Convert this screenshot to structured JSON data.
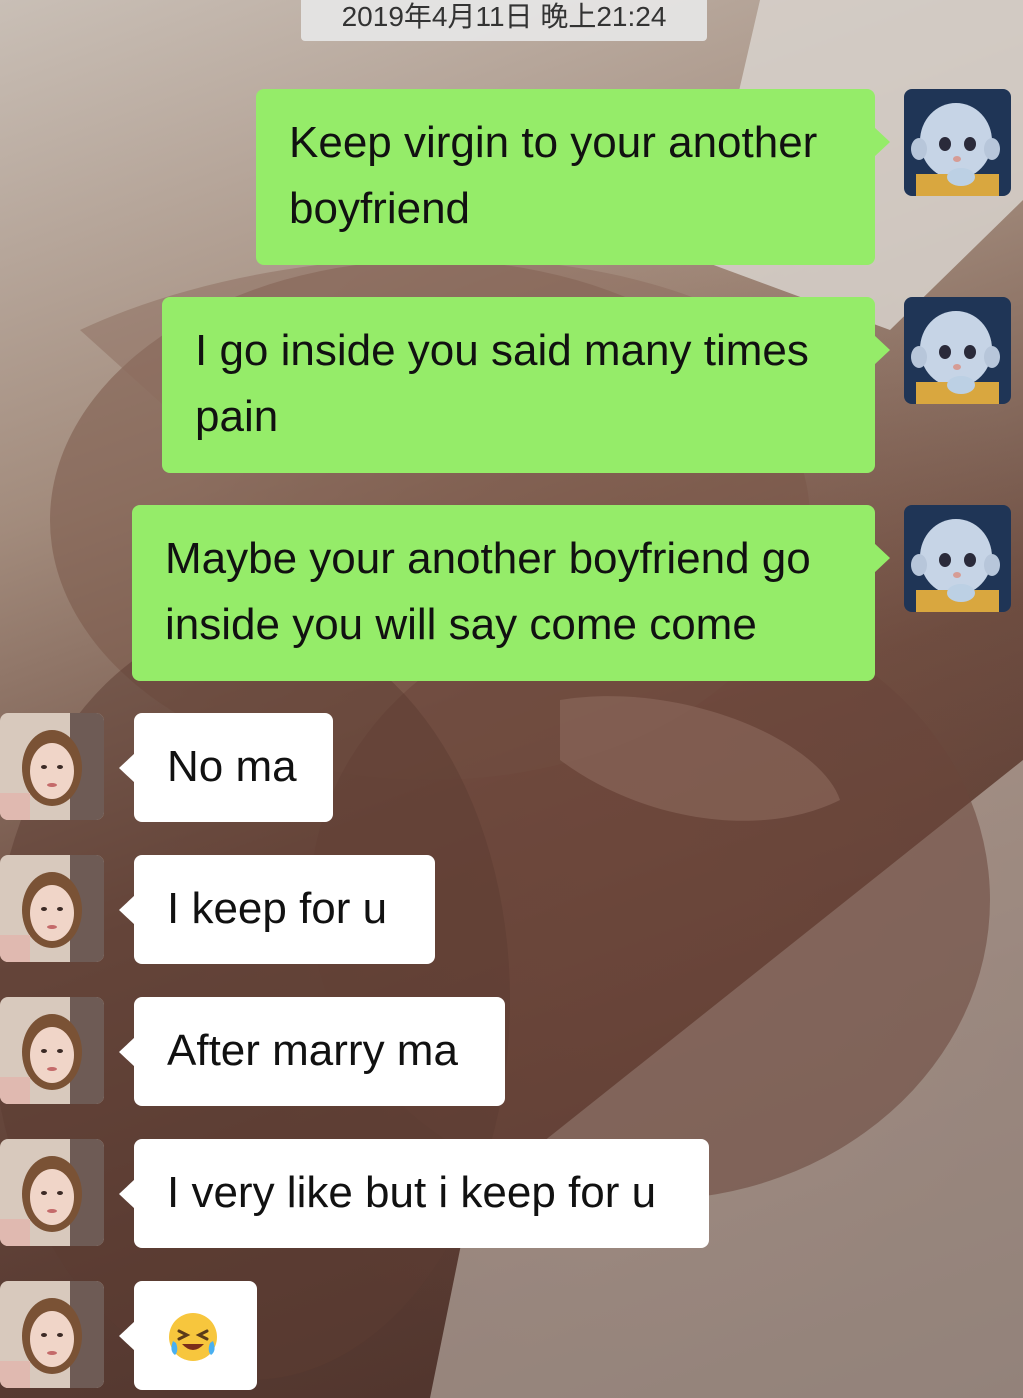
{
  "chat": {
    "timestamp": "2019年4月11日 晚上21:24",
    "messages": [
      {
        "side": "out",
        "text": "Keep virgin to your another boyfriend"
      },
      {
        "side": "out",
        "text": "I go inside you said many times pain"
      },
      {
        "side": "out",
        "text": "Maybe your another boyfriend go inside you will say come come"
      },
      {
        "side": "in",
        "text": "No ma"
      },
      {
        "side": "in",
        "text": "I keep for u"
      },
      {
        "side": "in",
        "text": "After marry ma"
      },
      {
        "side": "in",
        "text": "I very like but i keep for u"
      },
      {
        "side": "in",
        "text": "😭",
        "icon": "crying-laughing-emoji-icon"
      }
    ]
  },
  "colors": {
    "outgoing_bubble": "#95ec69",
    "incoming_bubble": "#ffffff"
  }
}
